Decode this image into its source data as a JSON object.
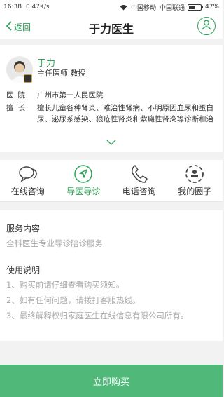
{
  "status_bar": {
    "time": "16:38",
    "speed": "0.47K/s",
    "carrier1": "中国移动",
    "carrier2": "中国联通",
    "battery": "47%",
    "battery_level": 0.47
  },
  "nav": {
    "back_label": "返回",
    "title": "于力医生"
  },
  "doctor": {
    "name": "于力",
    "title": "主任医师 教授",
    "hospital_label": "医院",
    "hospital": "广州市第一人民医院",
    "specialty_label": "擅长",
    "specialty": "擅长儿童各种肾炎、难治性肾病、不明原因血尿和蛋白尿、泌尿系感染、狼疮性肾炎和紫癜性肾炎等诊断和治"
  },
  "tabs": [
    {
      "label": "在线咨询",
      "icon": "chat-bubbles-icon",
      "active": false
    },
    {
      "label": "导医导诊",
      "icon": "navigation-arrow-icon",
      "active": true
    },
    {
      "label": "电话咨询",
      "icon": "phone-icon",
      "active": false
    },
    {
      "label": "我的圈子",
      "icon": "circle-group-icon",
      "active": false
    }
  ],
  "service": {
    "heading": "服务内容",
    "text": "全科医生专业导诊陪诊服务"
  },
  "usage": {
    "heading": "使用说明",
    "items": [
      "1、购买前请仔细查看购买须知。",
      "2、如有任何问题，请拨打客服热线。",
      "3、最终解释权归家庭医生在线信息有限公司所有。"
    ]
  },
  "buy_button": "立即购买",
  "colors": {
    "accent": "#2fa35a",
    "buy_button": "#50b878"
  }
}
